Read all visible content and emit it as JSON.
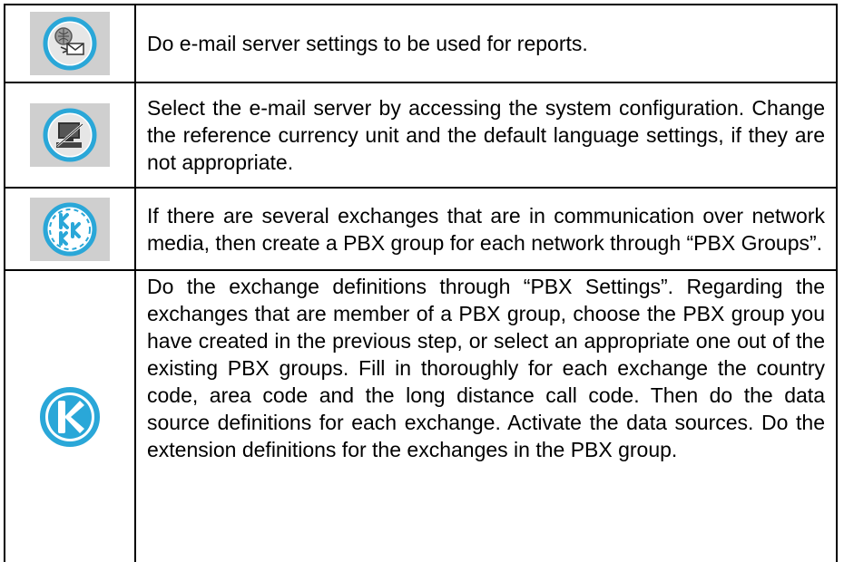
{
  "rows": [
    {
      "icon": "email-server-icon",
      "text": "Do e-mail server settings to be used for reports."
    },
    {
      "icon": "system-configuration-icon",
      "text": "Select the e-mail server by accessing the system configuration. Change the reference currency unit and the default language settings, if they are not appropriate."
    },
    {
      "icon": "pbx-group-icon",
      "text": "If there are several exchanges that are in communication over network media, then create a PBX group for each network through “PBX Groups”."
    },
    {
      "icon": "pbx-settings-icon",
      "text": "Do the exchange definitions through “PBX Settings”. Regarding the exchanges that are member of a PBX group, choose the PBX group you have created in the previous step, or select an appropriate one out of the existing PBX groups. Fill in thoroughly for each exchange the country code, area code and the long distance call code. Then do the data source definitions for each exchange. Activate the data sources. Do the extension definitions for the exchanges in the PBX group."
    }
  ],
  "colors": {
    "icon_ring": "#2aa7d8",
    "icon_tile": "#cfcfcf"
  }
}
